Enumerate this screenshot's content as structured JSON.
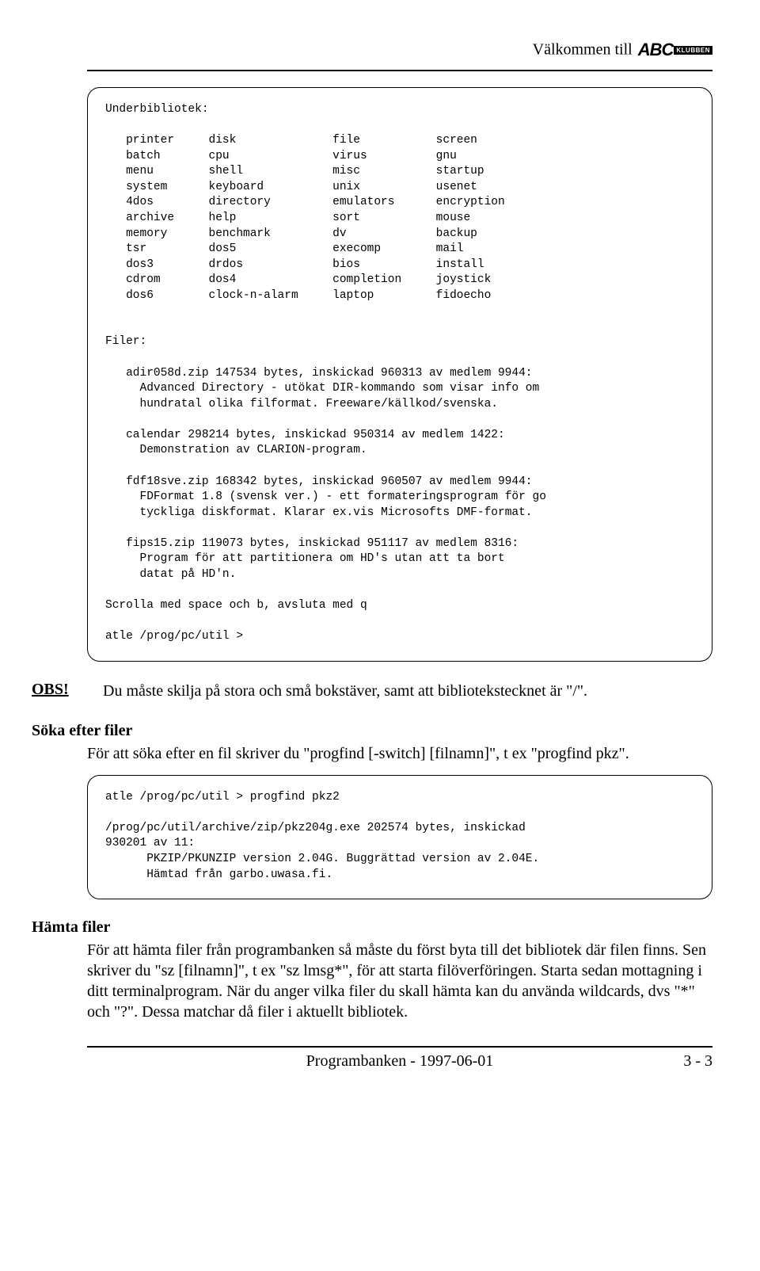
{
  "header": {
    "welcome": "Välkommen till",
    "logo_abc": "ABC",
    "logo_klubben": "KLUBBEN"
  },
  "box1": {
    "title": "Underbibliotek:",
    "table": [
      [
        "printer",
        "disk",
        "file",
        "screen"
      ],
      [
        "batch",
        "cpu",
        "virus",
        "gnu"
      ],
      [
        "menu",
        "shell",
        "misc",
        "startup"
      ],
      [
        "system",
        "keyboard",
        "unix",
        "usenet"
      ],
      [
        "4dos",
        "directory",
        "emulators",
        "encryption"
      ],
      [
        "archive",
        "help",
        "sort",
        "mouse"
      ],
      [
        "memory",
        "benchmark",
        "dv",
        "backup"
      ],
      [
        "tsr",
        "dos5",
        "execomp",
        "mail"
      ],
      [
        "dos3",
        "drdos",
        "bios",
        "install"
      ],
      [
        "cdrom",
        "dos4",
        "completion",
        "joystick"
      ],
      [
        "dos6",
        "clock-n-alarm",
        "laptop",
        "fidoecho"
      ]
    ],
    "files_heading": "Filer:",
    "files": [
      "   adir058d.zip 147534 bytes, inskickad 960313 av medlem 9944:\n     Advanced Directory - utökat DIR-kommando som visar info om\n     hundratal olika filformat. Freeware/källkod/svenska.",
      "   calendar 298214 bytes, inskickad 950314 av medlem 1422:\n     Demonstration av CLARION-program.",
      "   fdf18sve.zip 168342 bytes, inskickad 960507 av medlem 9944:\n     FDFormat 1.8 (svensk ver.) - ett formateringsprogram för go\n     tyckliga diskformat. Klarar ex.vis Microsofts DMF-format.",
      "   fips15.zip 119073 bytes, inskickad 951117 av medlem 8316:\n     Program för att partitionera om HD's utan att ta bort\n     datat på HD'n."
    ],
    "scroll_line": "Scrolla med space och b, avsluta med q",
    "prompt": "atle /prog/pc/util >"
  },
  "obs": {
    "label": "OBS!",
    "text": "Du måste skilja på stora och små bokstäver, samt att bibliotekstecknet är \"/\"."
  },
  "search": {
    "heading": "Söka efter filer",
    "text": "För att söka efter en fil skriver du \"progfind [-switch] [filnamn]\", t ex \"progfind pkz\"."
  },
  "box2": {
    "text": "atle /prog/pc/util > progfind pkz2\n\n/prog/pc/util/archive/zip/pkz204g.exe 202574 bytes, inskickad\n930201 av 11:\n      PKZIP/PKUNZIP version 2.04G. Buggrättad version av 2.04E.\n      Hämtad från garbo.uwasa.fi."
  },
  "fetch": {
    "heading": "Hämta filer",
    "text": "För att hämta filer från programbanken så måste du först byta till det bibliotek där filen finns. Sen skriver du \"sz [filnamn]\", t ex \"sz lmsg*\", för att starta filöverföringen. Starta sedan mottagning i ditt terminalprogram. När du anger vilka filer du skall hämta kan du använda wildcards, dvs \"*\" och \"?\". Dessa matchar då filer i aktuellt bibliotek."
  },
  "footer": {
    "center": "Programbanken - 1997-06-01",
    "right": "3 - 3"
  }
}
